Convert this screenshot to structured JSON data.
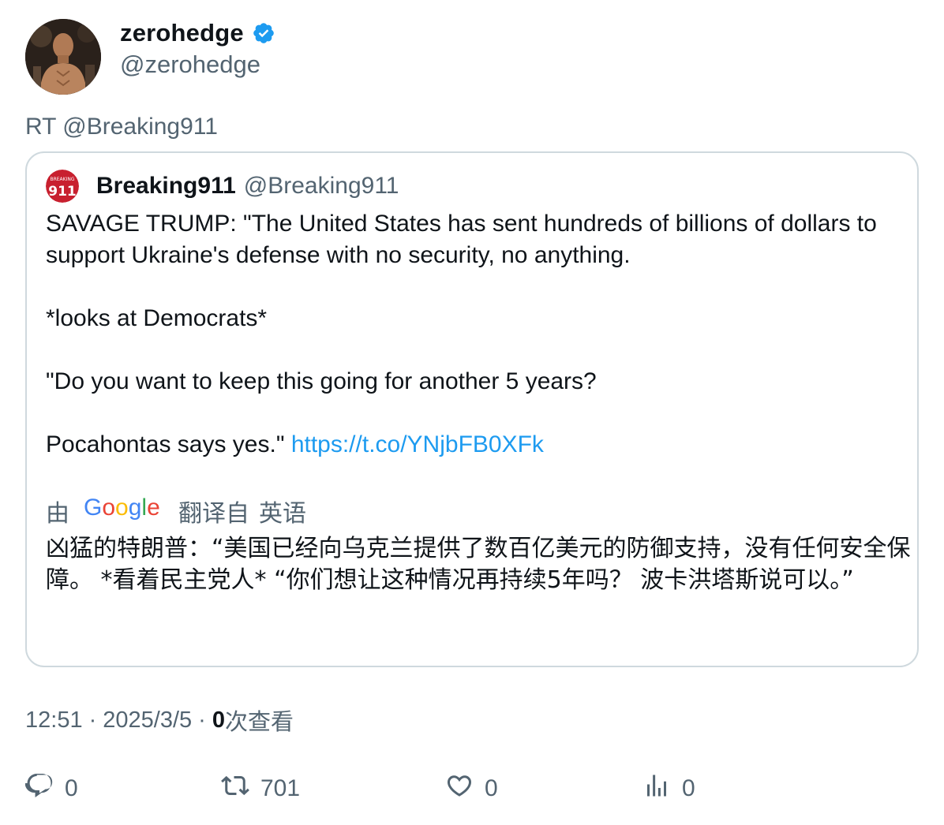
{
  "author": {
    "display_name": "zerohedge",
    "handle": "@zerohedge",
    "verified": true,
    "verified_color": "#1d9bf0"
  },
  "retweet_line": "RT @Breaking911",
  "quoted": {
    "display_name": "Breaking911",
    "handle": "@Breaking911",
    "avatar_color": "#c8202f",
    "paragraphs": [
      "SAVAGE TRUMP: \"The United States has sent hundreds of billions of dollars to support Ukraine's defense with no security, no anything.",
      "*looks at Democrats*",
      "\"Do you want to keep this going for another 5 years?"
    ],
    "last_paragraph_text": "Pocahontas says yes.\" ",
    "link_text": "https://t.co/YNjbFB0XFk",
    "link_color": "#1d9bf0",
    "translation": {
      "by_label": "由",
      "provider_logo": "Google",
      "translated_from_label": "翻译自",
      "source_language": "英语",
      "text": "凶猛的特朗普：“美国已经向乌克兰提供了数百亿美元的防御支持，没有任何安全保障。 *看着民主党人* “你们想让这种情况再持续5年吗？ 波卡洪塔斯说可以。”"
    }
  },
  "meta": {
    "time": "12:51",
    "date": "2025/3/5",
    "separator": "·",
    "views_count": "0",
    "views_label": "次查看"
  },
  "actions": {
    "reply_count": "0",
    "retweet_count": "701",
    "like_count": "0",
    "views_count": "0"
  },
  "colors": {
    "text_primary": "#0f1419",
    "text_secondary": "#536471",
    "border": "#cfd9de"
  }
}
